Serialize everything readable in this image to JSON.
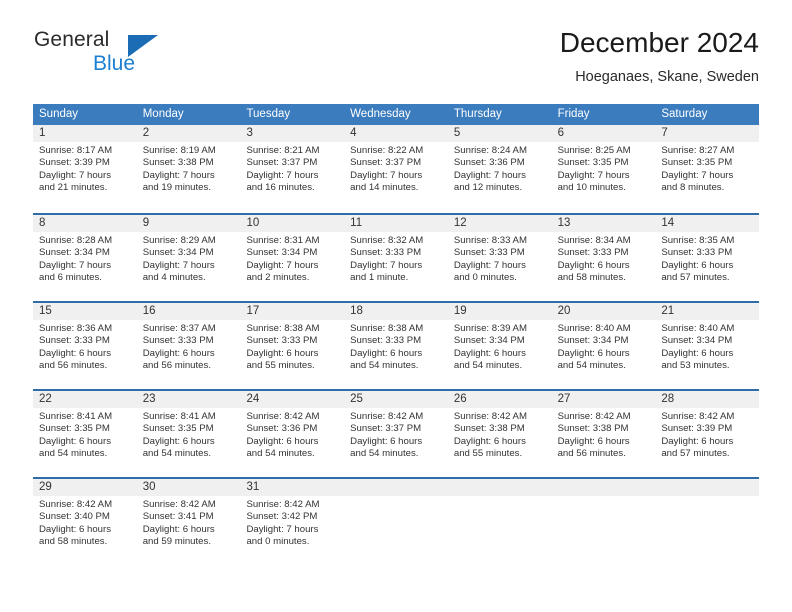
{
  "brand": {
    "name_top": "General",
    "name_bottom": "Blue",
    "accent_color": "#1c7fd1",
    "triangle_color": "#1c6cb5"
  },
  "header": {
    "title": "December 2024",
    "subtitle": "Hoeganaes, Skane, Sweden"
  },
  "theme": {
    "header_row_bg": "#3a7cbe",
    "week_separator": "#2f6da8",
    "daynum_band_bg": "#f0f0f0",
    "text_color": "#333333"
  },
  "weekdays": [
    "Sunday",
    "Monday",
    "Tuesday",
    "Wednesday",
    "Thursday",
    "Friday",
    "Saturday"
  ],
  "weeks": [
    [
      {
        "day": "1",
        "sunrise": "Sunrise: 8:17 AM",
        "sunset": "Sunset: 3:39 PM",
        "daylight_1": "Daylight: 7 hours",
        "daylight_2": "and 21 minutes."
      },
      {
        "day": "2",
        "sunrise": "Sunrise: 8:19 AM",
        "sunset": "Sunset: 3:38 PM",
        "daylight_1": "Daylight: 7 hours",
        "daylight_2": "and 19 minutes."
      },
      {
        "day": "3",
        "sunrise": "Sunrise: 8:21 AM",
        "sunset": "Sunset: 3:37 PM",
        "daylight_1": "Daylight: 7 hours",
        "daylight_2": "and 16 minutes."
      },
      {
        "day": "4",
        "sunrise": "Sunrise: 8:22 AM",
        "sunset": "Sunset: 3:37 PM",
        "daylight_1": "Daylight: 7 hours",
        "daylight_2": "and 14 minutes."
      },
      {
        "day": "5",
        "sunrise": "Sunrise: 8:24 AM",
        "sunset": "Sunset: 3:36 PM",
        "daylight_1": "Daylight: 7 hours",
        "daylight_2": "and 12 minutes."
      },
      {
        "day": "6",
        "sunrise": "Sunrise: 8:25 AM",
        "sunset": "Sunset: 3:35 PM",
        "daylight_1": "Daylight: 7 hours",
        "daylight_2": "and 10 minutes."
      },
      {
        "day": "7",
        "sunrise": "Sunrise: 8:27 AM",
        "sunset": "Sunset: 3:35 PM",
        "daylight_1": "Daylight: 7 hours",
        "daylight_2": "and 8 minutes."
      }
    ],
    [
      {
        "day": "8",
        "sunrise": "Sunrise: 8:28 AM",
        "sunset": "Sunset: 3:34 PM",
        "daylight_1": "Daylight: 7 hours",
        "daylight_2": "and 6 minutes."
      },
      {
        "day": "9",
        "sunrise": "Sunrise: 8:29 AM",
        "sunset": "Sunset: 3:34 PM",
        "daylight_1": "Daylight: 7 hours",
        "daylight_2": "and 4 minutes."
      },
      {
        "day": "10",
        "sunrise": "Sunrise: 8:31 AM",
        "sunset": "Sunset: 3:34 PM",
        "daylight_1": "Daylight: 7 hours",
        "daylight_2": "and 2 minutes."
      },
      {
        "day": "11",
        "sunrise": "Sunrise: 8:32 AM",
        "sunset": "Sunset: 3:33 PM",
        "daylight_1": "Daylight: 7 hours",
        "daylight_2": "and 1 minute."
      },
      {
        "day": "12",
        "sunrise": "Sunrise: 8:33 AM",
        "sunset": "Sunset: 3:33 PM",
        "daylight_1": "Daylight: 7 hours",
        "daylight_2": "and 0 minutes."
      },
      {
        "day": "13",
        "sunrise": "Sunrise: 8:34 AM",
        "sunset": "Sunset: 3:33 PM",
        "daylight_1": "Daylight: 6 hours",
        "daylight_2": "and 58 minutes."
      },
      {
        "day": "14",
        "sunrise": "Sunrise: 8:35 AM",
        "sunset": "Sunset: 3:33 PM",
        "daylight_1": "Daylight: 6 hours",
        "daylight_2": "and 57 minutes."
      }
    ],
    [
      {
        "day": "15",
        "sunrise": "Sunrise: 8:36 AM",
        "sunset": "Sunset: 3:33 PM",
        "daylight_1": "Daylight: 6 hours",
        "daylight_2": "and 56 minutes."
      },
      {
        "day": "16",
        "sunrise": "Sunrise: 8:37 AM",
        "sunset": "Sunset: 3:33 PM",
        "daylight_1": "Daylight: 6 hours",
        "daylight_2": "and 56 minutes."
      },
      {
        "day": "17",
        "sunrise": "Sunrise: 8:38 AM",
        "sunset": "Sunset: 3:33 PM",
        "daylight_1": "Daylight: 6 hours",
        "daylight_2": "and 55 minutes."
      },
      {
        "day": "18",
        "sunrise": "Sunrise: 8:38 AM",
        "sunset": "Sunset: 3:33 PM",
        "daylight_1": "Daylight: 6 hours",
        "daylight_2": "and 54 minutes."
      },
      {
        "day": "19",
        "sunrise": "Sunrise: 8:39 AM",
        "sunset": "Sunset: 3:34 PM",
        "daylight_1": "Daylight: 6 hours",
        "daylight_2": "and 54 minutes."
      },
      {
        "day": "20",
        "sunrise": "Sunrise: 8:40 AM",
        "sunset": "Sunset: 3:34 PM",
        "daylight_1": "Daylight: 6 hours",
        "daylight_2": "and 54 minutes."
      },
      {
        "day": "21",
        "sunrise": "Sunrise: 8:40 AM",
        "sunset": "Sunset: 3:34 PM",
        "daylight_1": "Daylight: 6 hours",
        "daylight_2": "and 53 minutes."
      }
    ],
    [
      {
        "day": "22",
        "sunrise": "Sunrise: 8:41 AM",
        "sunset": "Sunset: 3:35 PM",
        "daylight_1": "Daylight: 6 hours",
        "daylight_2": "and 54 minutes."
      },
      {
        "day": "23",
        "sunrise": "Sunrise: 8:41 AM",
        "sunset": "Sunset: 3:35 PM",
        "daylight_1": "Daylight: 6 hours",
        "daylight_2": "and 54 minutes."
      },
      {
        "day": "24",
        "sunrise": "Sunrise: 8:42 AM",
        "sunset": "Sunset: 3:36 PM",
        "daylight_1": "Daylight: 6 hours",
        "daylight_2": "and 54 minutes."
      },
      {
        "day": "25",
        "sunrise": "Sunrise: 8:42 AM",
        "sunset": "Sunset: 3:37 PM",
        "daylight_1": "Daylight: 6 hours",
        "daylight_2": "and 54 minutes."
      },
      {
        "day": "26",
        "sunrise": "Sunrise: 8:42 AM",
        "sunset": "Sunset: 3:38 PM",
        "daylight_1": "Daylight: 6 hours",
        "daylight_2": "and 55 minutes."
      },
      {
        "day": "27",
        "sunrise": "Sunrise: 8:42 AM",
        "sunset": "Sunset: 3:38 PM",
        "daylight_1": "Daylight: 6 hours",
        "daylight_2": "and 56 minutes."
      },
      {
        "day": "28",
        "sunrise": "Sunrise: 8:42 AM",
        "sunset": "Sunset: 3:39 PM",
        "daylight_1": "Daylight: 6 hours",
        "daylight_2": "and 57 minutes."
      }
    ],
    [
      {
        "day": "29",
        "sunrise": "Sunrise: 8:42 AM",
        "sunset": "Sunset: 3:40 PM",
        "daylight_1": "Daylight: 6 hours",
        "daylight_2": "and 58 minutes."
      },
      {
        "day": "30",
        "sunrise": "Sunrise: 8:42 AM",
        "sunset": "Sunset: 3:41 PM",
        "daylight_1": "Daylight: 6 hours",
        "daylight_2": "and 59 minutes."
      },
      {
        "day": "31",
        "sunrise": "Sunrise: 8:42 AM",
        "sunset": "Sunset: 3:42 PM",
        "daylight_1": "Daylight: 7 hours",
        "daylight_2": "and 0 minutes."
      },
      {
        "day": "",
        "sunrise": "",
        "sunset": "",
        "daylight_1": "",
        "daylight_2": ""
      },
      {
        "day": "",
        "sunrise": "",
        "sunset": "",
        "daylight_1": "",
        "daylight_2": ""
      },
      {
        "day": "",
        "sunrise": "",
        "sunset": "",
        "daylight_1": "",
        "daylight_2": ""
      },
      {
        "day": "",
        "sunrise": "",
        "sunset": "",
        "daylight_1": "",
        "daylight_2": ""
      }
    ]
  ]
}
